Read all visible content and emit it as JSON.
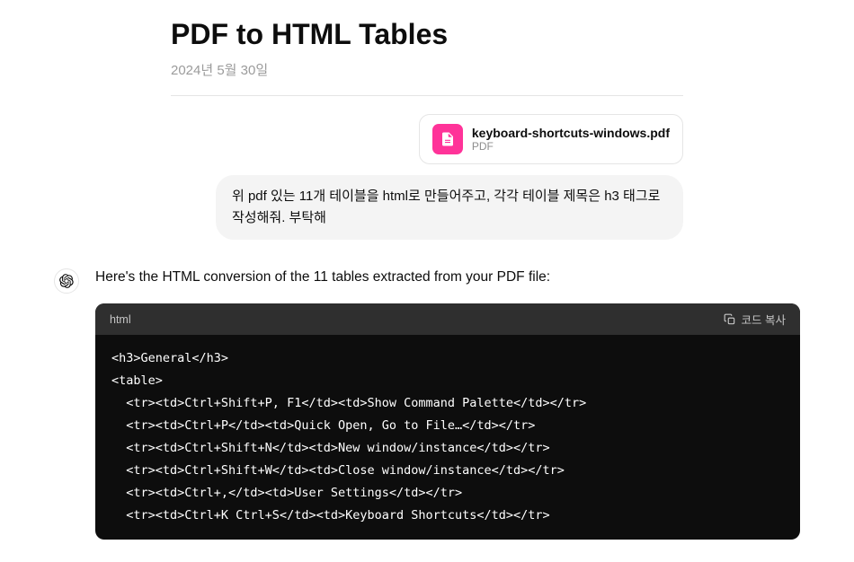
{
  "header": {
    "title": "PDF to HTML Tables",
    "date": "2024년 5월 30일"
  },
  "attachment": {
    "filename": "keyboard-shortcuts-windows.pdf",
    "filetype": "PDF"
  },
  "user_message": "위 pdf 있는 11개 테이블을 html로 만들어주고, 각각 테이블 제목은 h3 태그로 작성해줘. 부탁해",
  "assistant_intro": "Here's the HTML conversion of the 11 tables extracted from your PDF file:",
  "code": {
    "language": "html",
    "copy_label": "코드 복사",
    "lines": [
      "<h3>General</h3>",
      "<table>",
      "  <tr><td>Ctrl+Shift+P, F1</td><td>Show Command Palette</td></tr>",
      "  <tr><td>Ctrl+P</td><td>Quick Open, Go to File…</td></tr>",
      "  <tr><td>Ctrl+Shift+N</td><td>New window/instance</td></tr>",
      "  <tr><td>Ctrl+Shift+W</td><td>Close window/instance</td></tr>",
      "  <tr><td>Ctrl+,</td><td>User Settings</td></tr>",
      "  <tr><td>Ctrl+K Ctrl+S</td><td>Keyboard Shortcuts</td></tr>"
    ]
  }
}
